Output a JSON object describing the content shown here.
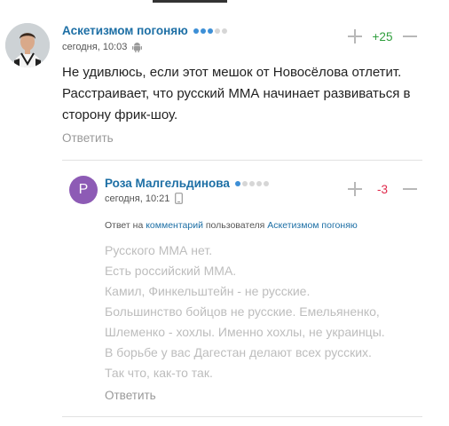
{
  "comment1": {
    "author": "Аскетизмом погоняю",
    "rank_dots": [
      true,
      true,
      true,
      false,
      false
    ],
    "timestamp": "сегодня, 10:03",
    "device_icon": "android-icon",
    "score": "+25",
    "score_color": "#2e9e3c",
    "text": "Не удивлюсь, если этот мешок от Новосёлова отлетит. Расстраивает, что русский ММА начинает развиваться в сторону фрик-шоу.",
    "reply_label": "Ответить"
  },
  "comment2": {
    "avatar_letter": "Р",
    "avatar_color": "#8d5bb5",
    "author": "Роза Малгельдинова",
    "rank_dots": [
      true,
      false,
      false,
      false,
      false
    ],
    "timestamp": "сегодня, 10:21",
    "device_icon": "phone-icon",
    "score": "-3",
    "score_color": "#e0294b",
    "reply_to_prefix": "Ответ на",
    "reply_to_link": "комментарий",
    "reply_to_middle": "пользователя",
    "reply_to_user": "Аскетизмом погоняю",
    "lines": [
      "Русского ММА нет.",
      "Есть российский ММА.",
      "Камил, Финкельштейн - не русские.",
      "Большинство бойцов не русские. Емельяненко, Шлеменко - хохлы. Именно хохлы, не украинцы.",
      "В борьбе у вас Дагестан делают всех русских.",
      "Так что, как-то так."
    ],
    "reply_label": "Ответить"
  }
}
